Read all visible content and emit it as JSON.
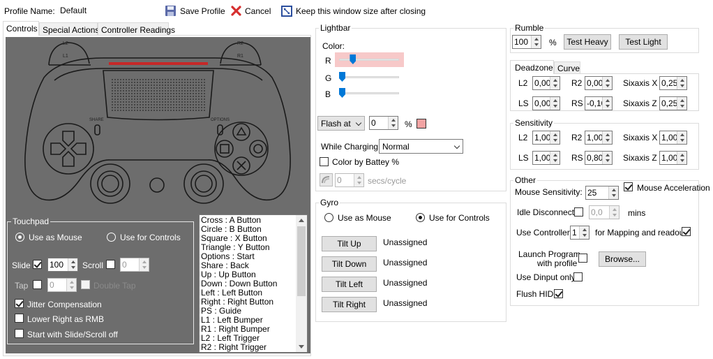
{
  "header": {
    "profile_name_label": "Profile Name:",
    "profile_name_value": "Default",
    "save_label": "Save Profile",
    "cancel_label": "Cancel",
    "keep_size_label": "Keep this window size after closing"
  },
  "tabs": [
    "Controls",
    "Special Actions",
    "Controller Readings"
  ],
  "controller": {
    "left_bumper_labels": [
      "L2",
      "L1"
    ],
    "right_bumper_labels": [
      "R2",
      "R1"
    ],
    "share_label": "SHARE",
    "options_label": "OPTIONS"
  },
  "touchpad": {
    "title": "Touchpad",
    "use_as_mouse": "Use as Mouse",
    "use_for_controls": "Use for Controls",
    "slide_label": "Slide",
    "slide_value": "100",
    "scroll_label": "Scroll",
    "scroll_value": "0",
    "tap_label": "Tap",
    "tap_value": "0",
    "double_tap_label": "Double Tap",
    "jitter_label": "Jitter Compensation",
    "lower_right_label": "Lower Right as RMB",
    "start_slide_label": "Start with Slide/Scroll off"
  },
  "mapping_list": [
    "Cross : A Button",
    "Circle : B Button",
    "Square : X Button",
    "Triangle : Y Button",
    "Options : Start",
    "Share : Back",
    "Up : Up Button",
    "Down : Down Button",
    "Left : Left Button",
    "Right : Right Button",
    "PS : Guide",
    "L1 : Left Bumper",
    "R1 : Right Bumper",
    "L2 : Left Trigger",
    "R2 : Right Trigger"
  ],
  "lightbar": {
    "title": "Lightbar",
    "color_label": "Color:",
    "r_label": "R",
    "g_label": "G",
    "b_label": "B",
    "r_level": 0.2,
    "g_level": 0.0,
    "b_level": 0.0,
    "flash_label": "Flash at",
    "flash_value": "0",
    "percent": "%",
    "flash_color": "#f2a3a3",
    "while_charging_label": "While Charging:",
    "while_charging_value": "Normal",
    "color_by_battery_label": "Color by Battey %",
    "secs_value": "0",
    "secs_label": "secs/cycle"
  },
  "gyro": {
    "title": "Gyro",
    "use_as_mouse": "Use as Mouse",
    "use_for_controls": "Use for Controls",
    "tilts": [
      {
        "button": "Tilt Up",
        "value": "Unassigned"
      },
      {
        "button": "Tilt Down",
        "value": "Unassigned"
      },
      {
        "button": "Tilt Left",
        "value": "Unassigned"
      },
      {
        "button": "Tilt Right",
        "value": "Unassigned"
      }
    ]
  },
  "rumble": {
    "title": "Rumble",
    "value": "100",
    "percent": "%",
    "test_heavy": "Test Heavy",
    "test_light": "Test Light"
  },
  "deadzone": {
    "tabs": [
      "Deadzone",
      "Curve"
    ],
    "l2_label": "L2",
    "l2_value": "0,00",
    "r2_label": "R2",
    "r2_value": "0,00",
    "sixaxis_x_label": "Sixaxis X",
    "sixaxis_x_value": "0,25",
    "ls_label": "LS",
    "ls_value": "0,00",
    "rs_label": "RS",
    "rs_value": "-0,10",
    "sixaxis_z_label": "Sixaxis Z",
    "sixaxis_z_value": "0,25"
  },
  "sensitivity": {
    "title": "Sensitivity",
    "l2_label": "L2",
    "l2_value": "1,00",
    "r2_label": "R2",
    "r2_value": "1,00",
    "sixaxis_x_label": "Sixaxis X",
    "sixaxis_x_value": "1,00",
    "ls_label": "LS",
    "ls_value": "1,00",
    "rs_label": "RS",
    "rs_value": "0,80",
    "sixaxis_z_label": "Sixaxis Z",
    "sixaxis_z_value": "1,00"
  },
  "other": {
    "title": "Other",
    "mouse_sensitivity_label": "Mouse Sensitivity:",
    "mouse_sensitivity_value": "25",
    "mouse_accel_label": "Mouse Acceleration",
    "idle_disconnect_label": "Idle Disconnect",
    "idle_value": "0,0",
    "mins_label": "mins",
    "use_controller_label": "Use Controller",
    "use_controller_value": "1",
    "mapping_readout_label": "for Mapping and readout",
    "launch_program_label_1": "Launch Program",
    "launch_program_label_2": "with profile",
    "browse_label": "Browse...",
    "use_dinput_label": "Use Dinput only",
    "flush_hid_label": "Flush HID"
  },
  "colors": {
    "panel_bg": "#6d6d6d",
    "lightbar_red": "#c62828",
    "accent": "#0078d7",
    "r_track_bg": "#f7c9c9"
  }
}
